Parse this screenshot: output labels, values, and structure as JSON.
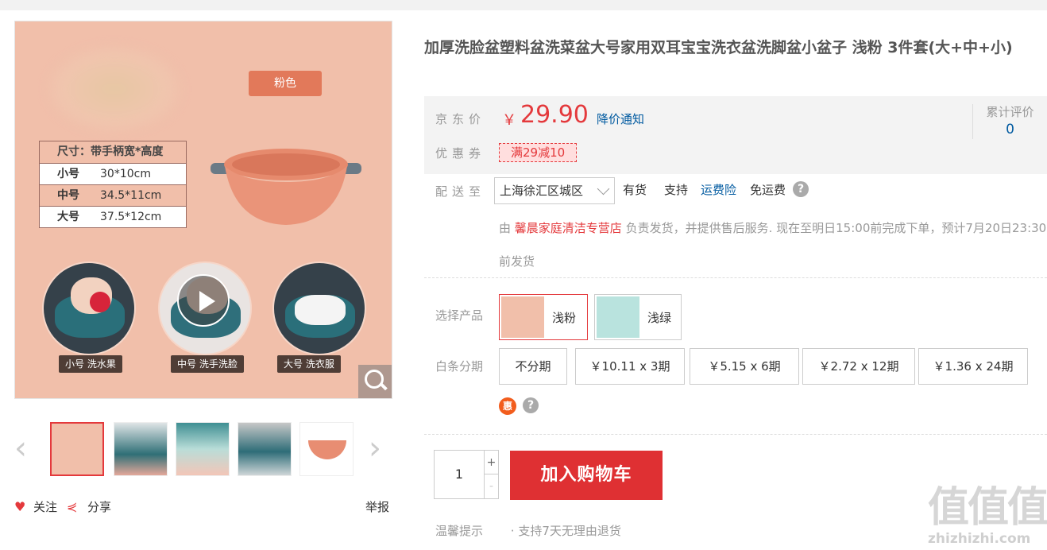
{
  "product": {
    "title": "加厚洗脸盆塑料盆洗菜盆大号家用双耳宝宝洗衣盆洗脚盆小盆子 浅粉 3件套(大+中+小)"
  },
  "gallery": {
    "color_tag": "粉色",
    "size_table": {
      "header": "尺寸：带手柄宽*高度",
      "rows": [
        {
          "size": "小号",
          "dims": "30*10cm"
        },
        {
          "size": "中号",
          "dims": "34.5*11cm"
        },
        {
          "size": "大号",
          "dims": "37.5*12cm"
        }
      ]
    },
    "captions": [
      "小号 洗水果",
      "中号 洗手洗脸",
      "大号 洗衣服"
    ],
    "thumbnail_count": 5,
    "active_thumbnail": 1
  },
  "social": {
    "follow": "关注",
    "share": "分享",
    "report": "举报"
  },
  "price": {
    "label": "京东价",
    "currency": "￥",
    "value": "29.90",
    "notify": "降价通知",
    "coupon_label": "优惠券",
    "coupon": "满29减10",
    "review_label": "累计评价",
    "review_count": "0"
  },
  "delivery": {
    "label": "配送至",
    "address": "上海徐汇区城区",
    "stock": "有货",
    "support": "支持",
    "insurance": "运费险",
    "free_shipping": "免运费",
    "help_icon": "?",
    "seller_prefix": "由",
    "shop_name": "馨晨家庭清洁专营店",
    "seller_text": "负责发货，并提供售后服务. 现在至明日15:00前完成下单，预计7月20日23:30前发货"
  },
  "choose": {
    "label": "选择产品",
    "variants": [
      {
        "name": "浅粉",
        "selected": true
      },
      {
        "name": "浅绿",
        "selected": false
      }
    ],
    "installment_label": "白条分期",
    "installments": [
      "不分期",
      "￥10.11 x 3期",
      "￥5.15 x 6期",
      "￥2.72 x 12期",
      "￥1.36 x 24期"
    ],
    "promo_icon": "惠"
  },
  "purchase": {
    "quantity": "1",
    "plus": "+",
    "minus": "-",
    "add_to_cart": "加入购物车"
  },
  "tips": {
    "label": "温馨提示",
    "text": "· 支持7天无理由退货"
  },
  "watermark": {
    "logo": "值值值",
    "url": "zhizhizhi.com"
  },
  "colors": {
    "accent_red": "#e4393c",
    "link_blue": "#005aa0",
    "product_pink": "#f1bfaa"
  }
}
